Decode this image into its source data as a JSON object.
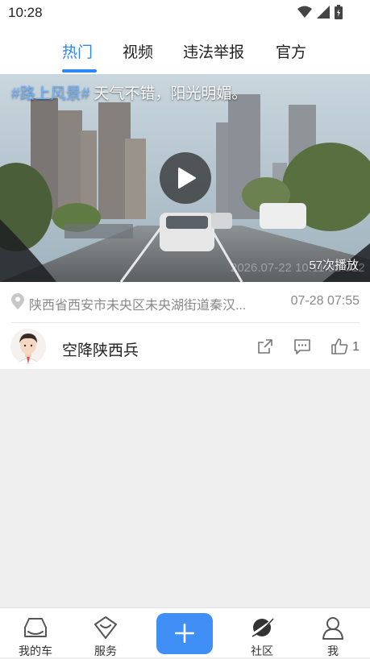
{
  "status_bar": {
    "time": "10:28"
  },
  "tabs": [
    {
      "label": "热门"
    },
    {
      "label": "视频"
    },
    {
      "label": "违法举报"
    },
    {
      "label": "官方"
    }
  ],
  "post": {
    "hashtag": "#路上风景#",
    "caption": " 天气不错，阳光明媚。",
    "video_timestamp": "2026.07-22 10:11:01.912",
    "play_count": "57次播放",
    "location": "陕西省西安市未央区未央湖街道秦汉...",
    "date": "07-28 07:55",
    "author": "空降陕西兵",
    "like_count": "1"
  },
  "bottom_nav": [
    {
      "label": "我的车",
      "icon": "car-icon"
    },
    {
      "label": "服务",
      "icon": "service-icon"
    },
    {
      "label": "",
      "icon": "plus-icon"
    },
    {
      "label": "社区",
      "icon": "planet-icon"
    },
    {
      "label": "我",
      "icon": "person-icon"
    }
  ],
  "colors": {
    "accent": "#2f86f6",
    "add_button": "#3f8ff7"
  }
}
